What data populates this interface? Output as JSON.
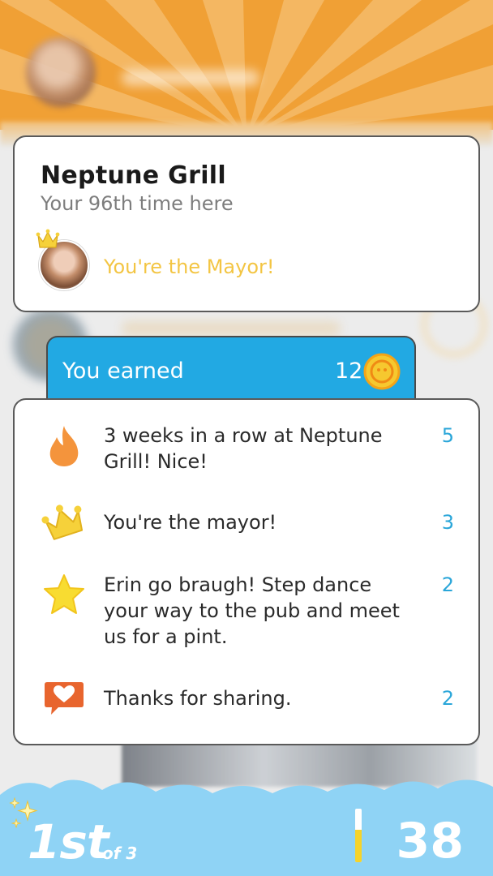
{
  "background": {
    "header_color": "#f0a035",
    "blurred": true
  },
  "venue": {
    "name": "Neptune Grill",
    "visits": "Your 96th time here",
    "mayor_text": "You're the Mayor!"
  },
  "earned": {
    "label": "You earned",
    "total": "12",
    "accent_color": "#22a9e3"
  },
  "rewards": [
    {
      "icon": "flame-icon",
      "text": "3 weeks in a row at Neptune Grill! Nice!",
      "points": "5"
    },
    {
      "icon": "crown-icon",
      "text": "You're the mayor!",
      "points": "3"
    },
    {
      "icon": "star-icon",
      "text": "Erin go braugh! Step dance your way to the pub and meet us for a pint.",
      "points": "2"
    },
    {
      "icon": "heart-speech-icon",
      "text": "Thanks for sharing.",
      "points": "2"
    }
  ],
  "leaderboard": {
    "rank": "1st",
    "of": "of 3",
    "score": "38",
    "progress_fraction": 0.6
  }
}
